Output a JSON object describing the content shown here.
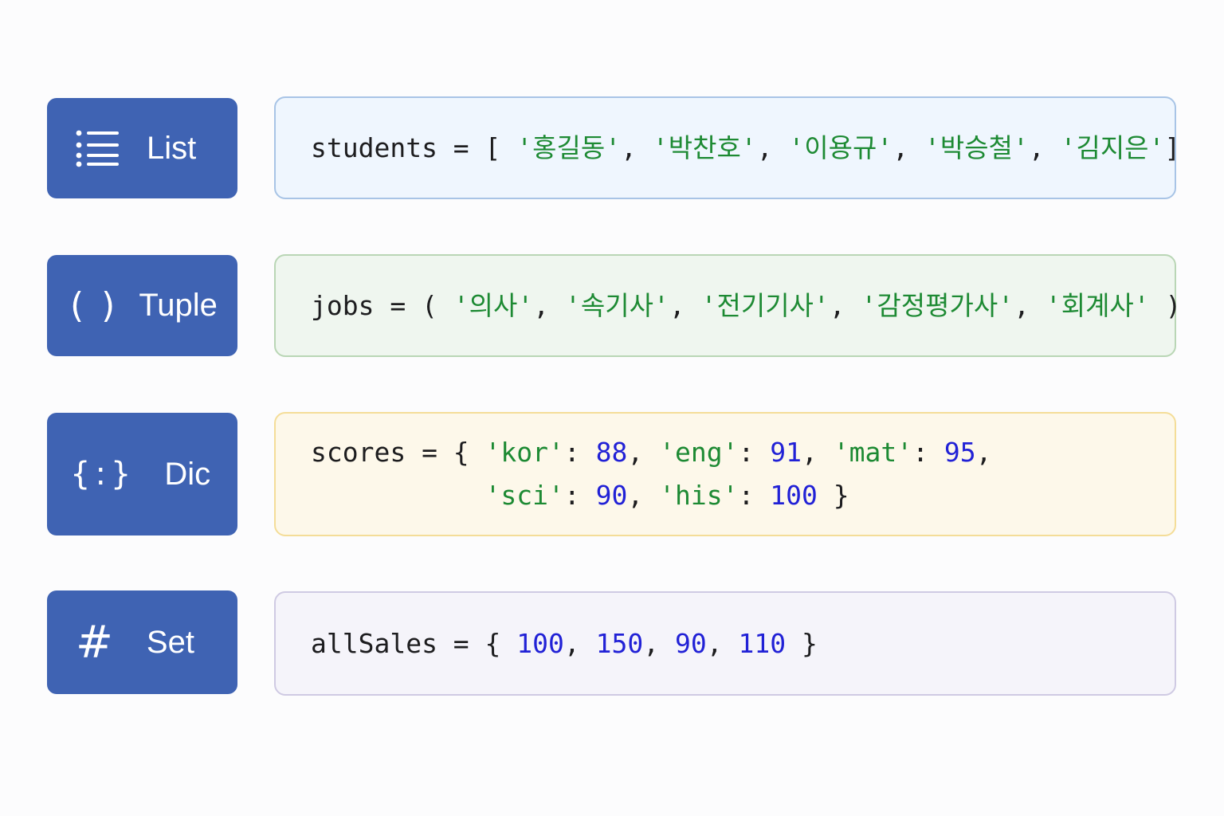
{
  "colors": {
    "badge_bg": "#3f63b3",
    "badge_text": "#ffffff",
    "string": "#1d8a33",
    "number": "#2121d6",
    "code_text": "#1d1d1f",
    "list_box_bg": "#eff6fe",
    "tuple_box_bg": "#eff6ef",
    "dic_box_bg": "#fdf8ea",
    "set_box_bg": "#f5f4fa"
  },
  "rows": [
    {
      "id": "list",
      "badge": {
        "icon": "list-icon",
        "label": "List"
      },
      "code_lines": [
        [
          {
            "t": "students = [ ",
            "k": "plain"
          },
          {
            "t": "'홍길동'",
            "k": "str"
          },
          {
            "t": ", ",
            "k": "plain"
          },
          {
            "t": "'박찬호'",
            "k": "str"
          },
          {
            "t": ", ",
            "k": "plain"
          },
          {
            "t": "'이용규'",
            "k": "str"
          },
          {
            "t": ", ",
            "k": "plain"
          },
          {
            "t": "'박승철'",
            "k": "str"
          },
          {
            "t": ", ",
            "k": "plain"
          },
          {
            "t": "'김지은'",
            "k": "str"
          },
          {
            "t": "]",
            "k": "plain"
          }
        ]
      ]
    },
    {
      "id": "tuple",
      "badge": {
        "icon": "parentheses-icon",
        "icon_text": "( )",
        "label": "Tuple"
      },
      "code_lines": [
        [
          {
            "t": "jobs = ( ",
            "k": "plain"
          },
          {
            "t": "'의사'",
            "k": "str"
          },
          {
            "t": ", ",
            "k": "plain"
          },
          {
            "t": "'속기사'",
            "k": "str"
          },
          {
            "t": ", ",
            "k": "plain"
          },
          {
            "t": "'전기기사'",
            "k": "str"
          },
          {
            "t": ", ",
            "k": "plain"
          },
          {
            "t": "'감정평가사'",
            "k": "str"
          },
          {
            "t": ", ",
            "k": "plain"
          },
          {
            "t": "'회계사'",
            "k": "str"
          },
          {
            "t": " )",
            "k": "plain"
          }
        ]
      ]
    },
    {
      "id": "dic",
      "badge": {
        "icon": "braces-colon-icon",
        "icon_text": "{:}",
        "label": "Dic"
      },
      "code_lines": [
        [
          {
            "t": "scores = { ",
            "k": "plain"
          },
          {
            "t": "'kor'",
            "k": "str"
          },
          {
            "t": ": ",
            "k": "plain"
          },
          {
            "t": "88",
            "k": "num"
          },
          {
            "t": ", ",
            "k": "plain"
          },
          {
            "t": "'eng'",
            "k": "str"
          },
          {
            "t": ": ",
            "k": "plain"
          },
          {
            "t": "91",
            "k": "num"
          },
          {
            "t": ", ",
            "k": "plain"
          },
          {
            "t": "'mat'",
            "k": "str"
          },
          {
            "t": ": ",
            "k": "plain"
          },
          {
            "t": "95",
            "k": "num"
          },
          {
            "t": ",",
            "k": "plain"
          }
        ],
        [
          {
            "t": "           ",
            "k": "plain"
          },
          {
            "t": "'sci'",
            "k": "str"
          },
          {
            "t": ": ",
            "k": "plain"
          },
          {
            "t": "90",
            "k": "num"
          },
          {
            "t": ", ",
            "k": "plain"
          },
          {
            "t": "'his'",
            "k": "str"
          },
          {
            "t": ": ",
            "k": "plain"
          },
          {
            "t": "100",
            "k": "num"
          },
          {
            "t": " }",
            "k": "plain"
          }
        ]
      ]
    },
    {
      "id": "set",
      "badge": {
        "icon": "hash-icon",
        "icon_text": "#",
        "label": "Set"
      },
      "code_lines": [
        [
          {
            "t": "allSales = { ",
            "k": "plain"
          },
          {
            "t": "100",
            "k": "num"
          },
          {
            "t": ", ",
            "k": "plain"
          },
          {
            "t": "150",
            "k": "num"
          },
          {
            "t": ", ",
            "k": "plain"
          },
          {
            "t": "90",
            "k": "num"
          },
          {
            "t": ", ",
            "k": "plain"
          },
          {
            "t": "110",
            "k": "num"
          },
          {
            "t": " }",
            "k": "plain"
          }
        ]
      ]
    }
  ]
}
